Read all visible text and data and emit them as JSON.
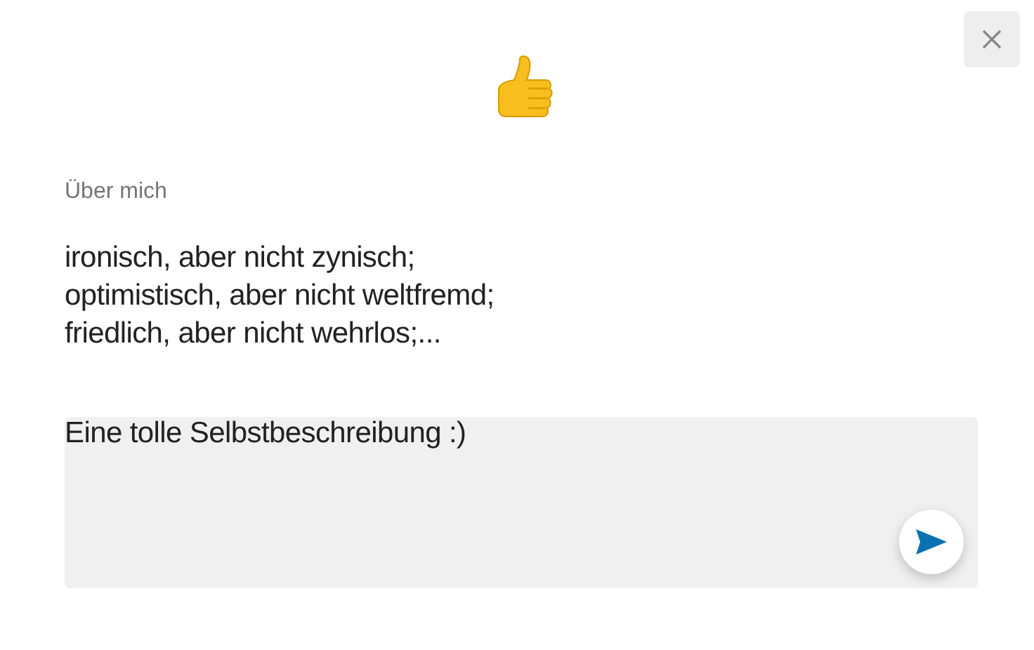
{
  "section": {
    "heading": "Über mich",
    "text": "ironisch, aber nicht zynisch;\noptimistisch, aber nicht weltfremd;\nfriedlich, aber nicht wehrlos;..."
  },
  "comment_field": {
    "value": "Eine tolle Selbstbeschreibung :)"
  }
}
